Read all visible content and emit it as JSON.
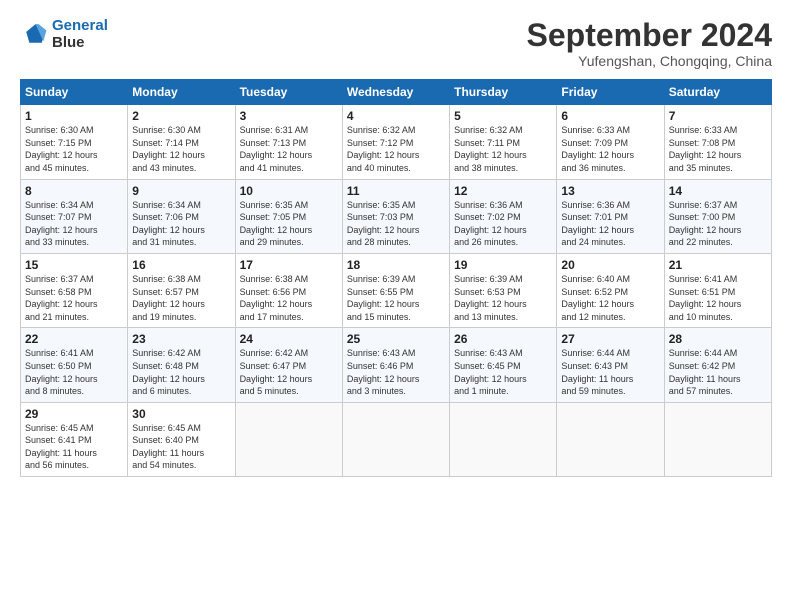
{
  "header": {
    "logo_line1": "General",
    "logo_line2": "Blue",
    "month": "September 2024",
    "location": "Yufengshan, Chongqing, China"
  },
  "weekdays": [
    "Sunday",
    "Monday",
    "Tuesday",
    "Wednesday",
    "Thursday",
    "Friday",
    "Saturday"
  ],
  "weeks": [
    [
      {
        "day": "1",
        "info": "Sunrise: 6:30 AM\nSunset: 7:15 PM\nDaylight: 12 hours\nand 45 minutes."
      },
      {
        "day": "2",
        "info": "Sunrise: 6:30 AM\nSunset: 7:14 PM\nDaylight: 12 hours\nand 43 minutes."
      },
      {
        "day": "3",
        "info": "Sunrise: 6:31 AM\nSunset: 7:13 PM\nDaylight: 12 hours\nand 41 minutes."
      },
      {
        "day": "4",
        "info": "Sunrise: 6:32 AM\nSunset: 7:12 PM\nDaylight: 12 hours\nand 40 minutes."
      },
      {
        "day": "5",
        "info": "Sunrise: 6:32 AM\nSunset: 7:11 PM\nDaylight: 12 hours\nand 38 minutes."
      },
      {
        "day": "6",
        "info": "Sunrise: 6:33 AM\nSunset: 7:09 PM\nDaylight: 12 hours\nand 36 minutes."
      },
      {
        "day": "7",
        "info": "Sunrise: 6:33 AM\nSunset: 7:08 PM\nDaylight: 12 hours\nand 35 minutes."
      }
    ],
    [
      {
        "day": "8",
        "info": "Sunrise: 6:34 AM\nSunset: 7:07 PM\nDaylight: 12 hours\nand 33 minutes."
      },
      {
        "day": "9",
        "info": "Sunrise: 6:34 AM\nSunset: 7:06 PM\nDaylight: 12 hours\nand 31 minutes."
      },
      {
        "day": "10",
        "info": "Sunrise: 6:35 AM\nSunset: 7:05 PM\nDaylight: 12 hours\nand 29 minutes."
      },
      {
        "day": "11",
        "info": "Sunrise: 6:35 AM\nSunset: 7:03 PM\nDaylight: 12 hours\nand 28 minutes."
      },
      {
        "day": "12",
        "info": "Sunrise: 6:36 AM\nSunset: 7:02 PM\nDaylight: 12 hours\nand 26 minutes."
      },
      {
        "day": "13",
        "info": "Sunrise: 6:36 AM\nSunset: 7:01 PM\nDaylight: 12 hours\nand 24 minutes."
      },
      {
        "day": "14",
        "info": "Sunrise: 6:37 AM\nSunset: 7:00 PM\nDaylight: 12 hours\nand 22 minutes."
      }
    ],
    [
      {
        "day": "15",
        "info": "Sunrise: 6:37 AM\nSunset: 6:58 PM\nDaylight: 12 hours\nand 21 minutes."
      },
      {
        "day": "16",
        "info": "Sunrise: 6:38 AM\nSunset: 6:57 PM\nDaylight: 12 hours\nand 19 minutes."
      },
      {
        "day": "17",
        "info": "Sunrise: 6:38 AM\nSunset: 6:56 PM\nDaylight: 12 hours\nand 17 minutes."
      },
      {
        "day": "18",
        "info": "Sunrise: 6:39 AM\nSunset: 6:55 PM\nDaylight: 12 hours\nand 15 minutes."
      },
      {
        "day": "19",
        "info": "Sunrise: 6:39 AM\nSunset: 6:53 PM\nDaylight: 12 hours\nand 13 minutes."
      },
      {
        "day": "20",
        "info": "Sunrise: 6:40 AM\nSunset: 6:52 PM\nDaylight: 12 hours\nand 12 minutes."
      },
      {
        "day": "21",
        "info": "Sunrise: 6:41 AM\nSunset: 6:51 PM\nDaylight: 12 hours\nand 10 minutes."
      }
    ],
    [
      {
        "day": "22",
        "info": "Sunrise: 6:41 AM\nSunset: 6:50 PM\nDaylight: 12 hours\nand 8 minutes."
      },
      {
        "day": "23",
        "info": "Sunrise: 6:42 AM\nSunset: 6:48 PM\nDaylight: 12 hours\nand 6 minutes."
      },
      {
        "day": "24",
        "info": "Sunrise: 6:42 AM\nSunset: 6:47 PM\nDaylight: 12 hours\nand 5 minutes."
      },
      {
        "day": "25",
        "info": "Sunrise: 6:43 AM\nSunset: 6:46 PM\nDaylight: 12 hours\nand 3 minutes."
      },
      {
        "day": "26",
        "info": "Sunrise: 6:43 AM\nSunset: 6:45 PM\nDaylight: 12 hours\nand 1 minute."
      },
      {
        "day": "27",
        "info": "Sunrise: 6:44 AM\nSunset: 6:43 PM\nDaylight: 11 hours\nand 59 minutes."
      },
      {
        "day": "28",
        "info": "Sunrise: 6:44 AM\nSunset: 6:42 PM\nDaylight: 11 hours\nand 57 minutes."
      }
    ],
    [
      {
        "day": "29",
        "info": "Sunrise: 6:45 AM\nSunset: 6:41 PM\nDaylight: 11 hours\nand 56 minutes."
      },
      {
        "day": "30",
        "info": "Sunrise: 6:45 AM\nSunset: 6:40 PM\nDaylight: 11 hours\nand 54 minutes."
      },
      {
        "day": "",
        "info": ""
      },
      {
        "day": "",
        "info": ""
      },
      {
        "day": "",
        "info": ""
      },
      {
        "day": "",
        "info": ""
      },
      {
        "day": "",
        "info": ""
      }
    ]
  ]
}
